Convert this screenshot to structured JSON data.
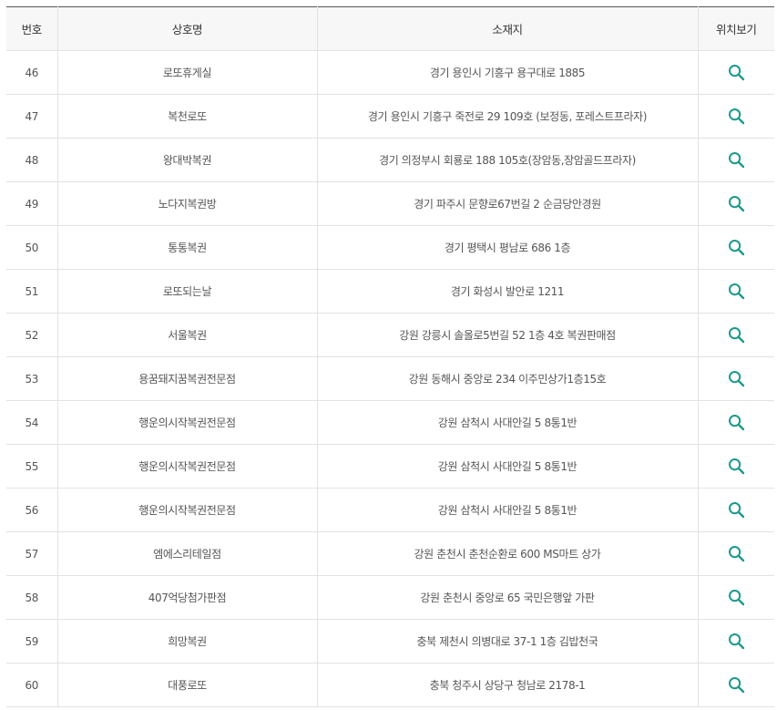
{
  "table": {
    "headers": {
      "no": "번호",
      "name": "상호명",
      "address": "소재지",
      "location": "위치보기"
    },
    "rows": [
      {
        "no": "46",
        "name": "로또휴게실",
        "address": "경기 용인시 기흥구 용구대로 1885"
      },
      {
        "no": "47",
        "name": "복천로또",
        "address": "경기 용인시 기흥구 죽전로 29 109호 (보정동, 포레스트프라자)"
      },
      {
        "no": "48",
        "name": "왕대박복권",
        "address": "경기 의정부시 회룡로 188 105호(장암동,장암골드프라자)"
      },
      {
        "no": "49",
        "name": "노다지복권방",
        "address": "경기 파주시 문향로67번길 2 순금당안경원"
      },
      {
        "no": "50",
        "name": "통통복권",
        "address": "경기 평택시 평남로 686 1층"
      },
      {
        "no": "51",
        "name": "로또되는날",
        "address": "경기 화성시 발안로 1211"
      },
      {
        "no": "52",
        "name": "서울복권",
        "address": "강원 강릉시 솔올로5번길 52 1층 4호 복권판매점"
      },
      {
        "no": "53",
        "name": "용꿈돼지꿈복권전문점",
        "address": "강원 동해시 중앙로 234 이주민상가1층15호"
      },
      {
        "no": "54",
        "name": "행운의시작복권전문점",
        "address": "강원 삼척시 사대안길 5 8통1반"
      },
      {
        "no": "55",
        "name": "행운의시작복권전문점",
        "address": "강원 삼척시 사대안길 5 8통1반"
      },
      {
        "no": "56",
        "name": "행운의시작복권전문점",
        "address": "강원 삼척시 사대안길 5 8통1반"
      },
      {
        "no": "57",
        "name": "엠에스리테일점",
        "address": "강원 춘천시 춘천순환로 600 MS마트 상가"
      },
      {
        "no": "58",
        "name": "407억당첨가판점",
        "address": "강원 춘천시 중앙로 65 국민은행앞 가판"
      },
      {
        "no": "59",
        "name": "희망복권",
        "address": "충북 제천시 의병대로 37-1 1층 김밥천국"
      },
      {
        "no": "60",
        "name": "대풍로또",
        "address": "충북 청주시 상당구 청남로 2178-1"
      }
    ]
  },
  "icons": {
    "location": "search-icon"
  },
  "colors": {
    "accent": "#1a9a8a",
    "header_bg": "#f7f7f7",
    "border": "#e2e2e2",
    "text": "#555555"
  }
}
